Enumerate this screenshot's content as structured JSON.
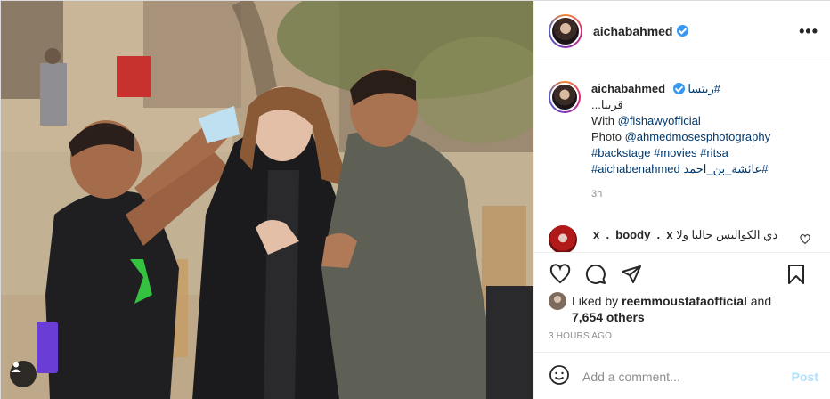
{
  "post": {
    "username": "aichabahmed",
    "caption_lines": [
      {
        "text": "#ريتسا",
        "kind": "tag"
      },
      {
        "text": "قريبا...",
        "kind": "plain"
      }
    ],
    "with_label": "With",
    "with_mention": "@fishawyofficial",
    "photo_label": "Photo",
    "photo_mention": "@ahmedmosesphotography",
    "tags_line1": "#backstage #movies #ritsa",
    "tags_line2a": "#aichabenahmed",
    "tags_line2b": "#عائشة_بن_احمد",
    "time": "3h"
  },
  "comment": {
    "username": "x_._boody_._x",
    "text": "دي الكواليس حاليا ولا",
    "overflow": "..."
  },
  "likes": {
    "prefix": "Liked by",
    "user": "reemmoustafaofficial",
    "and": "and",
    "count": "7,654 others"
  },
  "posted_ago": "3 hours ago",
  "add_comment": {
    "placeholder": "Add a comment...",
    "post_label": "Post"
  },
  "icons": [
    "heart-icon",
    "comment-icon",
    "share-icon",
    "save-icon",
    "emoji-icon",
    "more-icon",
    "user-tag-icon"
  ],
  "colors": {
    "link": "#00376b",
    "verified": "#3897f0",
    "muted": "#8e8e8e",
    "post_disabled": "#b2dffc"
  }
}
